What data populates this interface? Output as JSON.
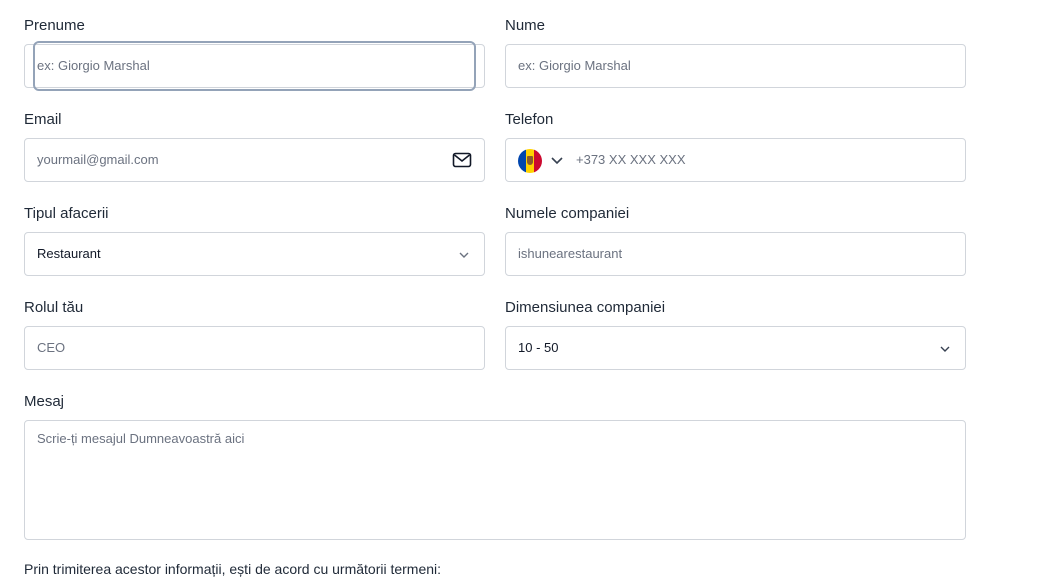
{
  "form": {
    "first_name": {
      "label": "Prenume",
      "placeholder": "ex: Giorgio Marshal"
    },
    "last_name": {
      "label": "Nume",
      "placeholder": "ex: Giorgio Marshal"
    },
    "email": {
      "label": "Email",
      "placeholder": "yourmail@gmail.com",
      "icon": "mail-icon"
    },
    "phone": {
      "label": "Telefon",
      "placeholder": "+373 XX XXX XXX",
      "country_flag": "moldova-flag-icon"
    },
    "business_type": {
      "label": "Tipul afacerii",
      "value": "Restaurant"
    },
    "company_name": {
      "label": "Numele companiei",
      "placeholder": "ishunearestaurant"
    },
    "role": {
      "label": "Rolul tău",
      "placeholder": "CEO"
    },
    "company_size": {
      "label": "Dimensiunea companiei",
      "value": "10 - 50"
    },
    "message": {
      "label": "Mesaj",
      "placeholder": "Scrie-ți mesajul Dumneavoastră aici"
    },
    "terms_text": "Prin trimiterea acestor informații, ești de acord cu următorii termeni:"
  },
  "colors": {
    "border": "#d1d5db",
    "focus_ring": "#94a3b8",
    "placeholder": "#6b7280",
    "text": "#1f2937"
  }
}
